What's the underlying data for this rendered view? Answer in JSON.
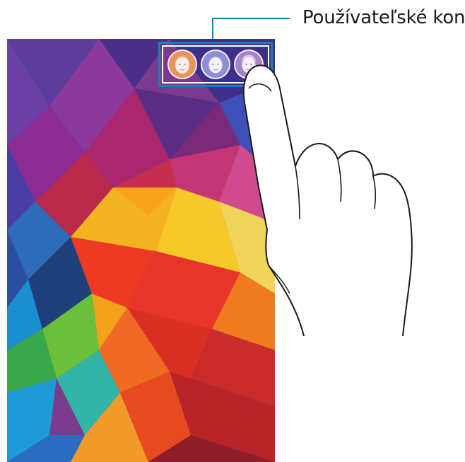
{
  "callout": {
    "label": "Používateľské kontá"
  },
  "lock_screen": {
    "blurred_texts": [
      "",
      "",
      "",
      "",
      ""
    ]
  },
  "users": [
    {
      "name": "user-1",
      "color": "#e9935b"
    },
    {
      "name": "user-2",
      "color": "#8e8fd8"
    },
    {
      "name": "user-3",
      "color": "#a784c9"
    }
  ]
}
